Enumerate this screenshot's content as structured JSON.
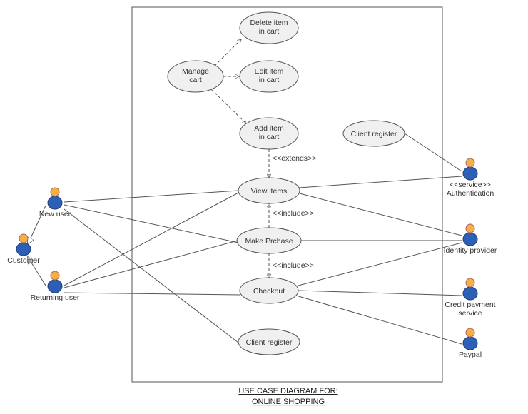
{
  "actors": {
    "customer": "Customer",
    "new_user": "New user",
    "returning_user": "Returning user",
    "authentication": "Authentication",
    "auth_stereo": "<<service>>",
    "identity_provider": "Identity provider",
    "credit_payment": "Credit payment\nservice",
    "paypal": "Paypal"
  },
  "usecases": {
    "manage_cart": "Manage\ncart",
    "delete_item": "Delete item\nin cart",
    "edit_item": "Edit item\nin cart",
    "add_item": "Add item\nin cart",
    "view_items": "View items",
    "make_purchase": "Make Prchase",
    "checkout": "Checkout",
    "client_register_top": "Client register",
    "client_register_bottom": "Client register"
  },
  "labels": {
    "extends": "<<extends>>",
    "include1": "<<include>>",
    "include2": "<<include>>"
  },
  "title": {
    "line1": "USE CASE DIAGRAM FOR:",
    "line2": "ONLINE SHOPPING"
  }
}
